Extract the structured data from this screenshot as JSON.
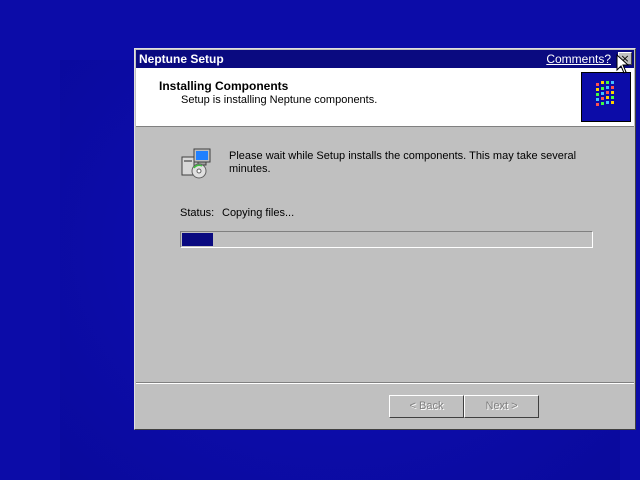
{
  "window": {
    "title": "Neptune Setup",
    "comments_link": "Comments?",
    "close_glyph": "×"
  },
  "header": {
    "title": "Installing Components",
    "subtitle": "Setup is installing Neptune components."
  },
  "body": {
    "message": "Please wait while Setup installs the components.  This may take several minutes.",
    "status_label": "Status:",
    "status_value": "Copying files...",
    "progress_fraction": 0.075
  },
  "buttons": {
    "back": "< Back",
    "next": "Next >"
  },
  "icons": {
    "installer": "installer-disk-icon",
    "logo": "setup-logo-icon",
    "cursor": "mouse-cursor-icon"
  },
  "colors": {
    "desktop": "#0c0ca8",
    "titlebar": "#0a0a80",
    "dialog": "#c0c0c0",
    "progress": "#0a0a80"
  }
}
